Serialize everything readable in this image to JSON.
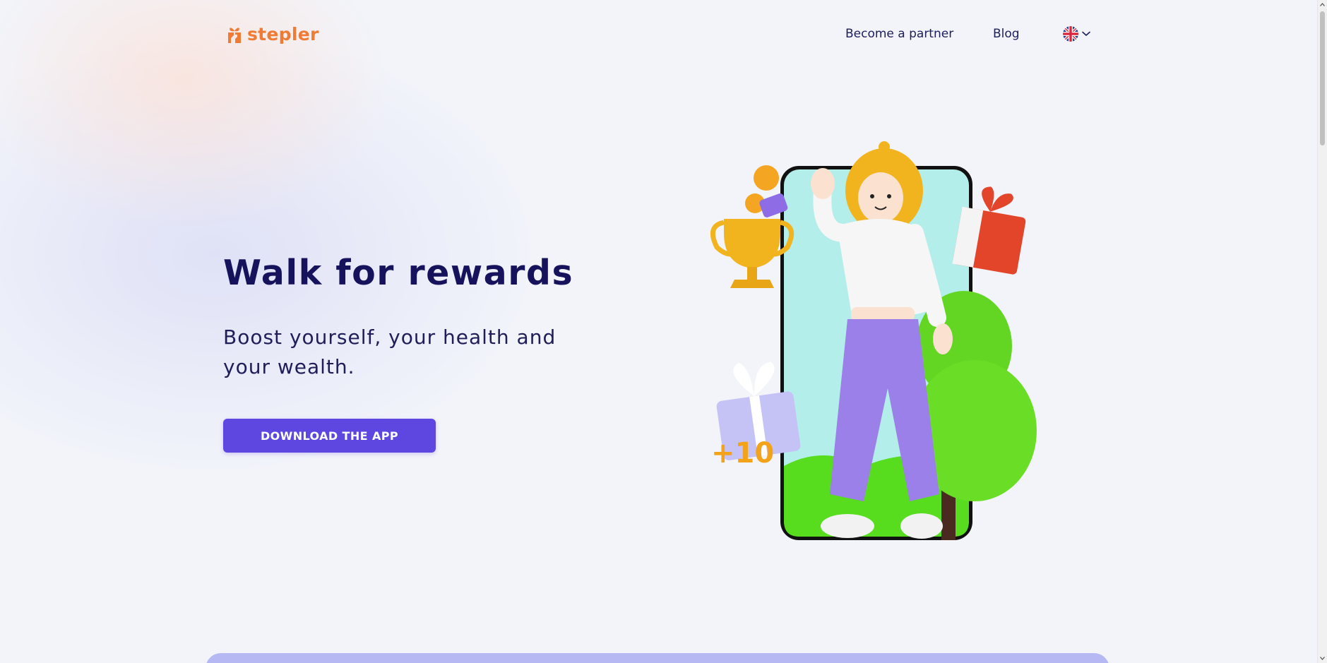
{
  "header": {
    "logo_text": "stepler",
    "nav": [
      {
        "label": "Become a partner"
      },
      {
        "label": "Blog"
      }
    ],
    "language": {
      "flag": "uk-flag-icon",
      "chevron": "chevron-down-icon"
    }
  },
  "hero": {
    "title": "Walk for rewards",
    "subtitle": "Boost yourself, your health and your wealth.",
    "cta_label": "DOWNLOAD THE APP",
    "illustration_badge": "+10"
  },
  "colors": {
    "brand_orange": "#f07b34",
    "heading_navy": "#16135c",
    "cta_purple": "#5d47e0",
    "section_lavender": "#b5b8f2"
  },
  "icons": [
    "logo-gift-icon",
    "uk-flag-icon",
    "chevron-down-icon"
  ]
}
